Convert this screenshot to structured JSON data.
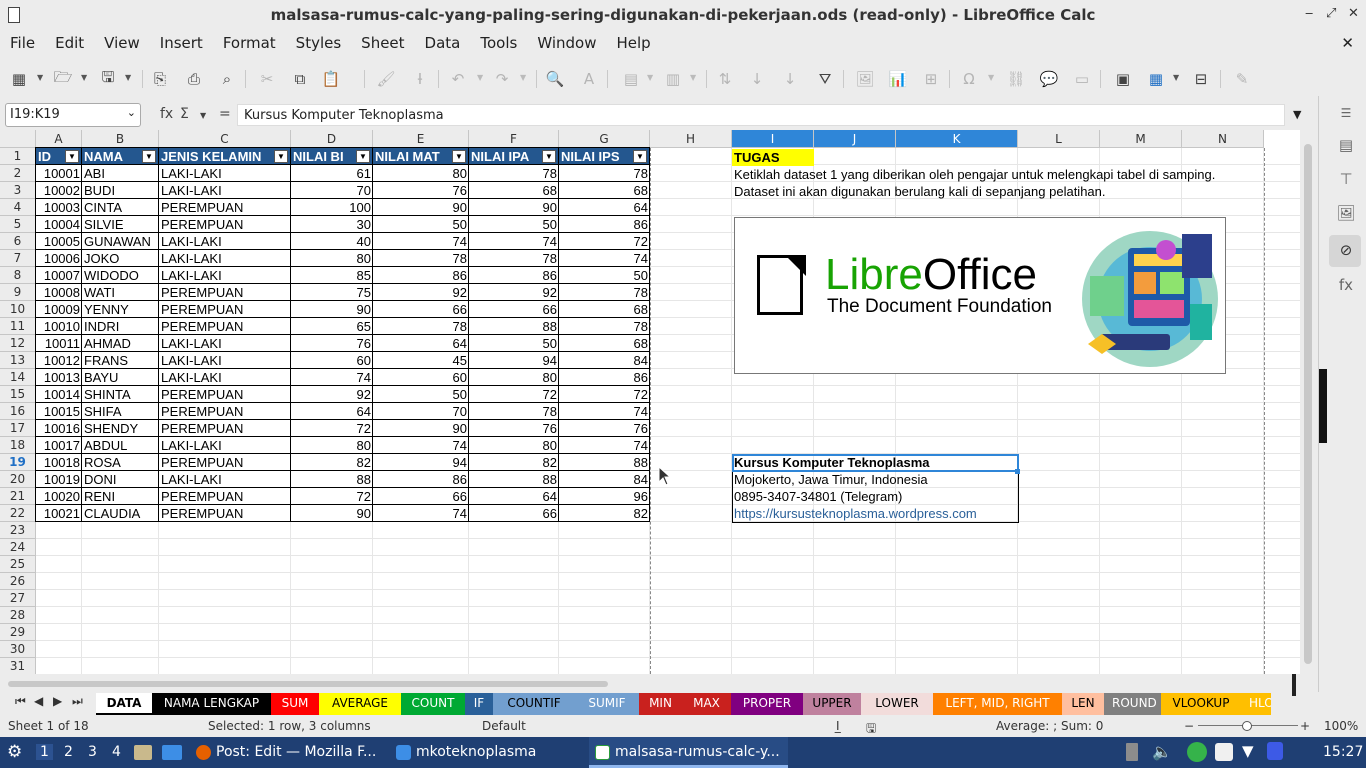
{
  "window": {
    "title": "malsasa-rumus-calc-yang-paling-sering-digunakan-di-pekerjaan.ods (read-only) - LibreOffice Calc",
    "minimize": "‒",
    "maximize": "⤢",
    "close": "✕"
  },
  "menu": [
    "File",
    "Edit",
    "View",
    "Insert",
    "Format",
    "Styles",
    "Sheet",
    "Data",
    "Tools",
    "Window",
    "Help"
  ],
  "close_document": "✕",
  "formula_bar": {
    "name_box": "I19:K19",
    "fx": "fx",
    "sigma": "Σ",
    "equals": "=",
    "content": "Kursus Komputer Teknoplasma"
  },
  "columns": [
    "A",
    "B",
    "C",
    "D",
    "E",
    "F",
    "G",
    "H",
    "I",
    "J",
    "K",
    "L",
    "M",
    "N"
  ],
  "rows": [
    "1",
    "2",
    "3",
    "4",
    "5",
    "6",
    "7",
    "8",
    "9",
    "10",
    "11",
    "12",
    "13",
    "14",
    "15",
    "16",
    "17",
    "18",
    "19",
    "20",
    "21",
    "22",
    "23",
    "24",
    "25",
    "26",
    "27",
    "28",
    "29",
    "30",
    "31"
  ],
  "table": {
    "headers": [
      "ID",
      "NAMA",
      "JENIS KELAMIN",
      "NILAI BI",
      "NILAI MAT",
      "NILAI IPA",
      "NILAI IPS"
    ],
    "rows": [
      [
        "10001",
        "ABI",
        "LAKI-LAKI",
        "61",
        "80",
        "78",
        "78"
      ],
      [
        "10002",
        "BUDI",
        "LAKI-LAKI",
        "70",
        "76",
        "68",
        "68"
      ],
      [
        "10003",
        "CINTA",
        "PEREMPUAN",
        "100",
        "90",
        "90",
        "64"
      ],
      [
        "10004",
        "SILVIE",
        "PEREMPUAN",
        "30",
        "50",
        "50",
        "86"
      ],
      [
        "10005",
        "GUNAWAN",
        "LAKI-LAKI",
        "40",
        "74",
        "74",
        "72"
      ],
      [
        "10006",
        "JOKO",
        "LAKI-LAKI",
        "80",
        "78",
        "78",
        "74"
      ],
      [
        "10007",
        "WIDODO",
        "LAKI-LAKI",
        "85",
        "86",
        "86",
        "50"
      ],
      [
        "10008",
        "WATI",
        "PEREMPUAN",
        "75",
        "92",
        "92",
        "78"
      ],
      [
        "10009",
        "YENNY",
        "PEREMPUAN",
        "90",
        "66",
        "66",
        "68"
      ],
      [
        "10010",
        "INDRI",
        "PEREMPUAN",
        "65",
        "78",
        "88",
        "78"
      ],
      [
        "10011",
        "AHMAD",
        "LAKI-LAKI",
        "76",
        "64",
        "50",
        "68"
      ],
      [
        "10012",
        "FRANS",
        "LAKI-LAKI",
        "60",
        "45",
        "94",
        "84"
      ],
      [
        "10013",
        "BAYU",
        "LAKI-LAKI",
        "74",
        "60",
        "80",
        "86"
      ],
      [
        "10014",
        "SHINTA",
        "PEREMPUAN",
        "92",
        "50",
        "72",
        "72"
      ],
      [
        "10015",
        "SHIFA",
        "PEREMPUAN",
        "64",
        "70",
        "78",
        "74"
      ],
      [
        "10016",
        "SHENDY",
        "PEREMPUAN",
        "72",
        "90",
        "76",
        "76"
      ],
      [
        "10017",
        "ABDUL",
        "LAKI-LAKI",
        "80",
        "74",
        "80",
        "74"
      ],
      [
        "10018",
        "ROSA",
        "PEREMPUAN",
        "82",
        "94",
        "82",
        "88"
      ],
      [
        "10019",
        "DONI",
        "LAKI-LAKI",
        "88",
        "86",
        "88",
        "84"
      ],
      [
        "10020",
        "RENI",
        "PEREMPUAN",
        "72",
        "66",
        "64",
        "96"
      ],
      [
        "10021",
        "CLAUDIA",
        "PEREMPUAN",
        "90",
        "74",
        "66",
        "82"
      ]
    ]
  },
  "task": {
    "label": "TUGAS",
    "line1": "Ketiklah dataset 1 yang diberikan oleh pengajar untuk melengkapi tabel di samping.",
    "line2": "Dataset ini akan digunakan berulang kali di sepanjang pelatihan."
  },
  "logo": {
    "brand_a": "Libre",
    "brand_b": "Office",
    "subtitle": "The Document Foundation"
  },
  "contact": {
    "name": "Kursus Komputer Teknoplasma",
    "location": "Mojokerto, Jawa Timur, Indonesia",
    "phone": "0895-3407-34801 (Telegram)",
    "url": "https://kursusteknoplasma.wordpress.com"
  },
  "tabs": [
    {
      "label": "DATA",
      "bg": "#ffffff",
      "fg": "#000000"
    },
    {
      "label": "NAMA LENGKAP",
      "bg": "#000000",
      "fg": "#ffffff"
    },
    {
      "label": "SUM",
      "bg": "#ff0000",
      "fg": "#ffffff"
    },
    {
      "label": "AVERAGE",
      "bg": "#ffff00",
      "fg": "#000000"
    },
    {
      "label": "COUNT",
      "bg": "#00a933",
      "fg": "#ffffff"
    },
    {
      "label": "IF",
      "bg": "#2a6099",
      "fg": "#ffffff"
    },
    {
      "label": "COUNTIF",
      "bg": "#729fcf",
      "fg": "#000000"
    },
    {
      "label": "SUMIF",
      "bg": "#729fcf",
      "fg": "#ffffff"
    },
    {
      "label": "MIN",
      "bg": "#c9211e",
      "fg": "#ffffff"
    },
    {
      "label": "MAX",
      "bg": "#c9211e",
      "fg": "#ffffff"
    },
    {
      "label": "PROPER",
      "bg": "#800080",
      "fg": "#ffffff"
    },
    {
      "label": "UPPER",
      "bg": "#bf819e",
      "fg": "#000000"
    },
    {
      "label": "LOWER",
      "bg": "#f2dcdb",
      "fg": "#000000"
    },
    {
      "label": "LEFT, MID, RIGHT",
      "bg": "#ff8000",
      "fg": "#ffffff"
    },
    {
      "label": "LEN",
      "bg": "#ffbf9f",
      "fg": "#000000"
    },
    {
      "label": "ROUND",
      "bg": "#808080",
      "fg": "#ffffff"
    },
    {
      "label": "VLOOKUP",
      "bg": "#ffbf00",
      "fg": "#000000"
    },
    {
      "label": "HLO",
      "bg": "#ffbf00",
      "fg": "#ffffff"
    }
  ],
  "status": {
    "sheet": "Sheet 1 of 18",
    "selection": "Selected: 1 row, 3 columns",
    "style": "Default",
    "calc": "Average: ; Sum: 0",
    "zoom": "100%",
    "minus": "−",
    "plus": "+"
  },
  "taskbar": {
    "workspaces": [
      "1",
      "2",
      "3",
      "4"
    ],
    "windows": [
      "Post: Edit — Mozilla F...",
      "mkoteknoplasma",
      "malsasa-rumus-calc-y..."
    ],
    "clock": "15:27"
  },
  "colors": {
    "header_blue": "#24578f",
    "selection_blue": "#2f86d8",
    "task_yellow": "#ffff00",
    "link": "#2a6099"
  }
}
